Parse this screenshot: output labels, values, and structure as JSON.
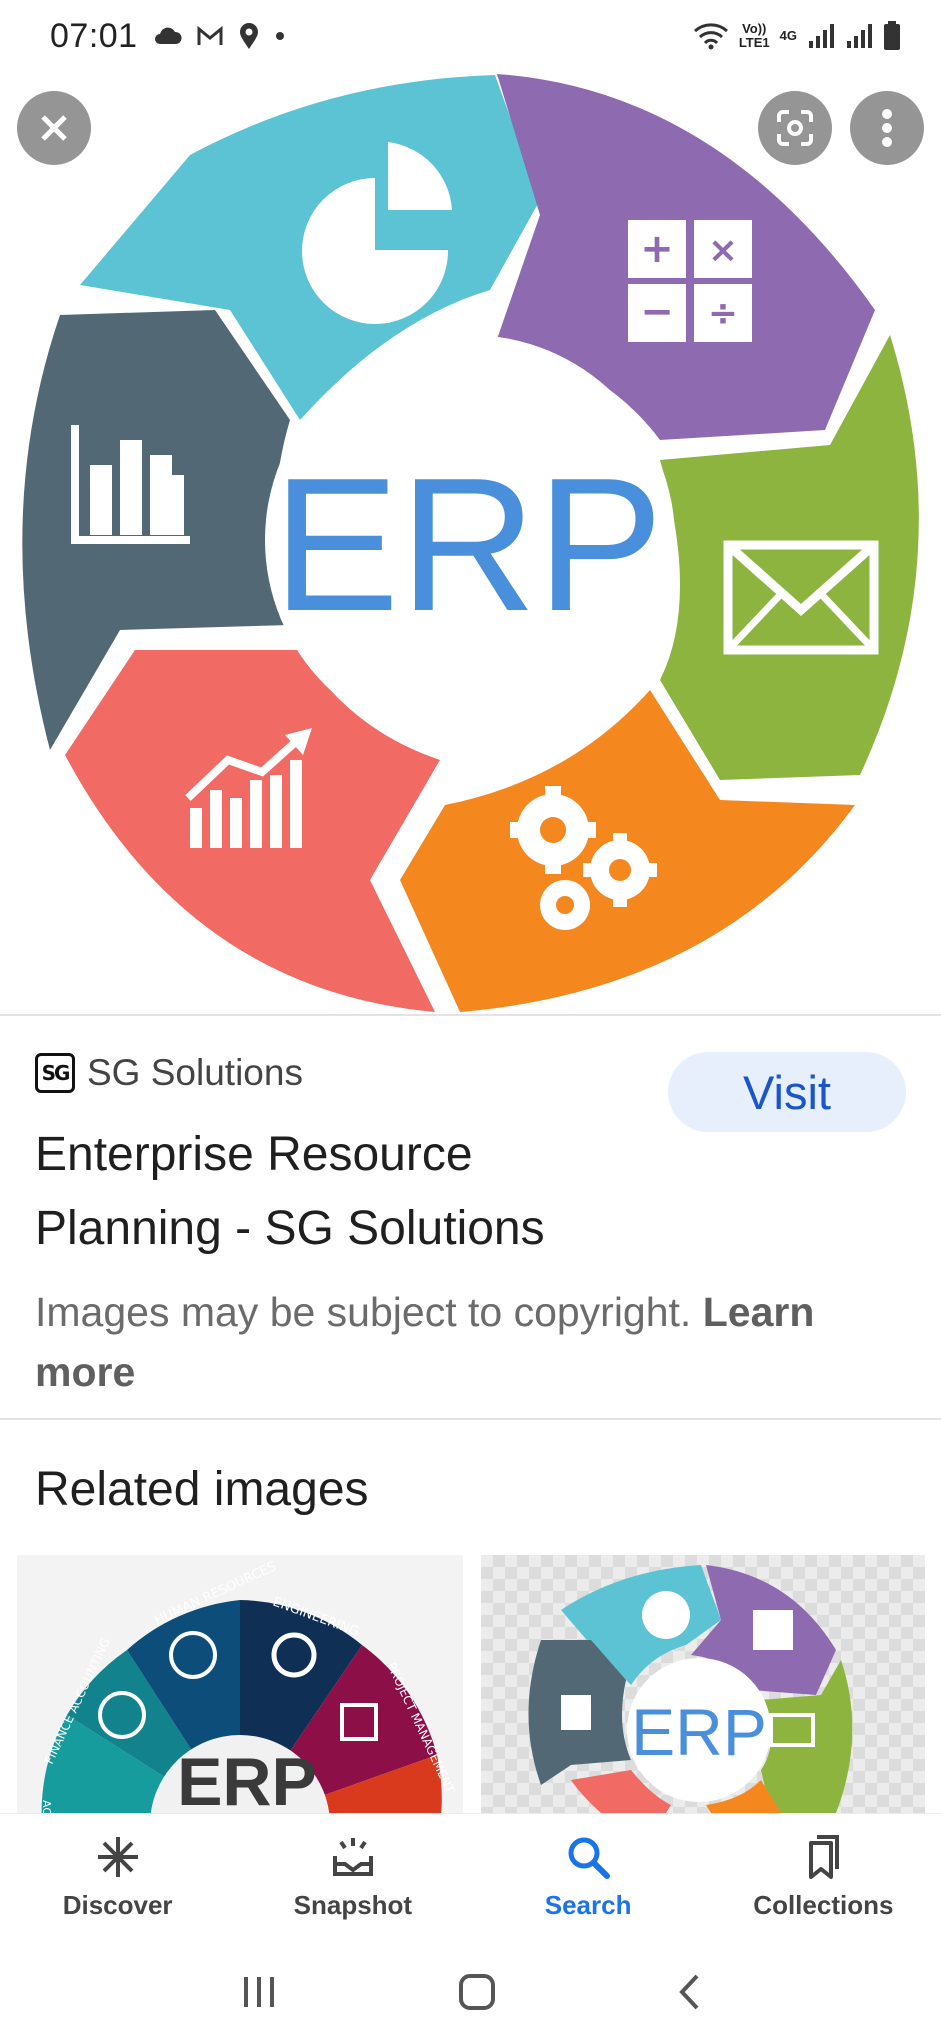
{
  "status_bar": {
    "time": "07:01",
    "network_volte": "Vo))",
    "network_lte": "LTE1",
    "network_4g": "4G",
    "left_icons": [
      "cloud-icon",
      "gmail-icon",
      "location-icon",
      "dot-icon"
    ],
    "right_icons": [
      "wifi-icon",
      "signal-icon",
      "signal-icon",
      "battery-icon"
    ]
  },
  "hero_image": {
    "center_text": "ERP",
    "segments": [
      {
        "icon": "pie-chart-icon",
        "color": "#5bc3d3"
      },
      {
        "icon": "calculator-icon",
        "color": "#8e6bb0"
      },
      {
        "icon": "envelope-icon",
        "color": "#8cb43f"
      },
      {
        "icon": "gears-icon",
        "color": "#f5871f"
      },
      {
        "icon": "trend-chart-icon",
        "color": "#f16a64"
      },
      {
        "icon": "bar-chart-icon",
        "color": "#536875"
      }
    ],
    "center_text_color": "#4a8fdb"
  },
  "overlay_buttons": {
    "close": "close-icon",
    "lens": "lens-icon",
    "more": "more-vert-icon"
  },
  "source": {
    "logo_text": "SG",
    "name": "SG Solutions",
    "visit_label": "Visit",
    "title": "Enterprise Resource Planning - SG Solutions",
    "copyright_text": "Images may be subject to copyright.",
    "learn_more": "Learn more"
  },
  "related": {
    "heading": "Related images",
    "thumbnails": [
      {
        "center_text": "ERP",
        "labels": [
          "HUMAN RESOURCES",
          "ENGINEERING",
          "FINANCE ACCOUNTING",
          "PROJECT MANAGEMENT",
          "ACC"
        ]
      },
      {
        "center_text": "ERP"
      }
    ]
  },
  "bottom_nav": {
    "items": [
      {
        "label": "Discover",
        "icon": "asterisk-icon",
        "active": false
      },
      {
        "label": "Snapshot",
        "icon": "snapshot-icon",
        "active": false
      },
      {
        "label": "Search",
        "icon": "search-icon",
        "active": true
      },
      {
        "label": "Collections",
        "icon": "collections-icon",
        "active": false
      }
    ],
    "active_color": "#1a73e8"
  },
  "system_nav": {
    "items": [
      "recents-icon",
      "home-icon",
      "back-icon"
    ]
  }
}
